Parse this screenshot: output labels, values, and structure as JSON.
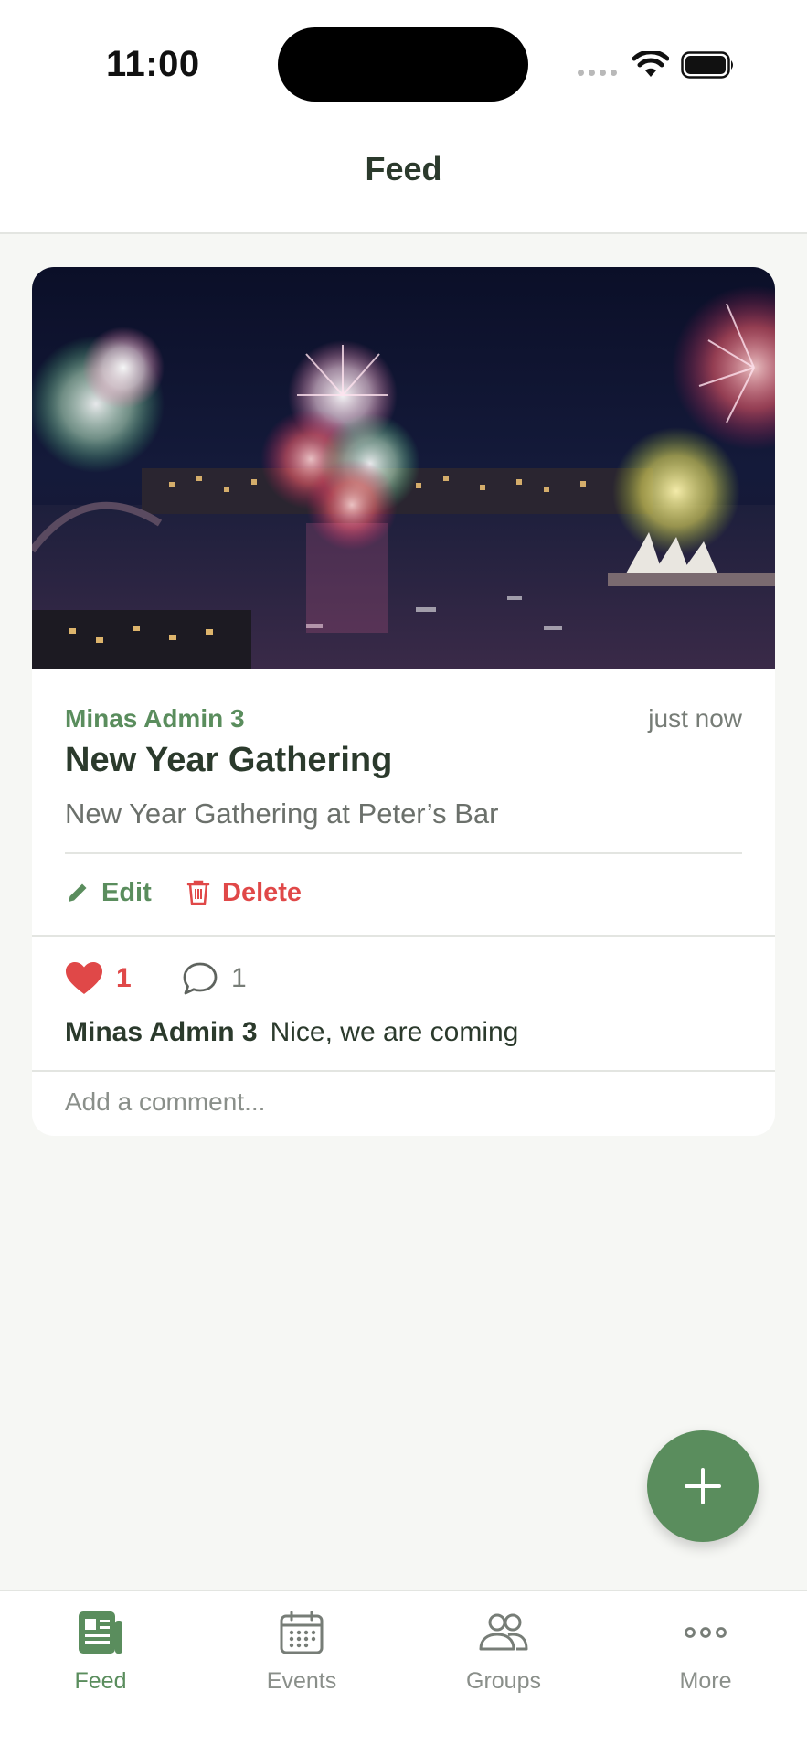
{
  "status_bar": {
    "time": "11:00"
  },
  "header": {
    "title": "Feed"
  },
  "post": {
    "author": "Minas Admin 3",
    "timestamp": "just now",
    "title": "New Year Gathering",
    "description": "New Year Gathering at Peter’s Bar",
    "edit_label": "Edit",
    "delete_label": "Delete",
    "like_count": "1",
    "comment_count": "1",
    "liked": true,
    "comments": [
      {
        "author": "Minas Admin 3",
        "text": "Nice, we are coming"
      }
    ],
    "comment_placeholder": "Add a comment..."
  },
  "fab": {
    "icon": "plus-icon"
  },
  "tab_bar": {
    "tabs": [
      {
        "label": "Feed",
        "icon": "feed-icon",
        "active": true
      },
      {
        "label": "Events",
        "icon": "calendar-icon",
        "active": false
      },
      {
        "label": "Groups",
        "icon": "groups-icon",
        "active": false
      },
      {
        "label": "More",
        "icon": "more-icon",
        "active": false
      }
    ]
  },
  "colors": {
    "accent": "#5a8d5d",
    "danger": "#e04848",
    "background": "#f6f7f4",
    "text": "#2b3a2c"
  }
}
